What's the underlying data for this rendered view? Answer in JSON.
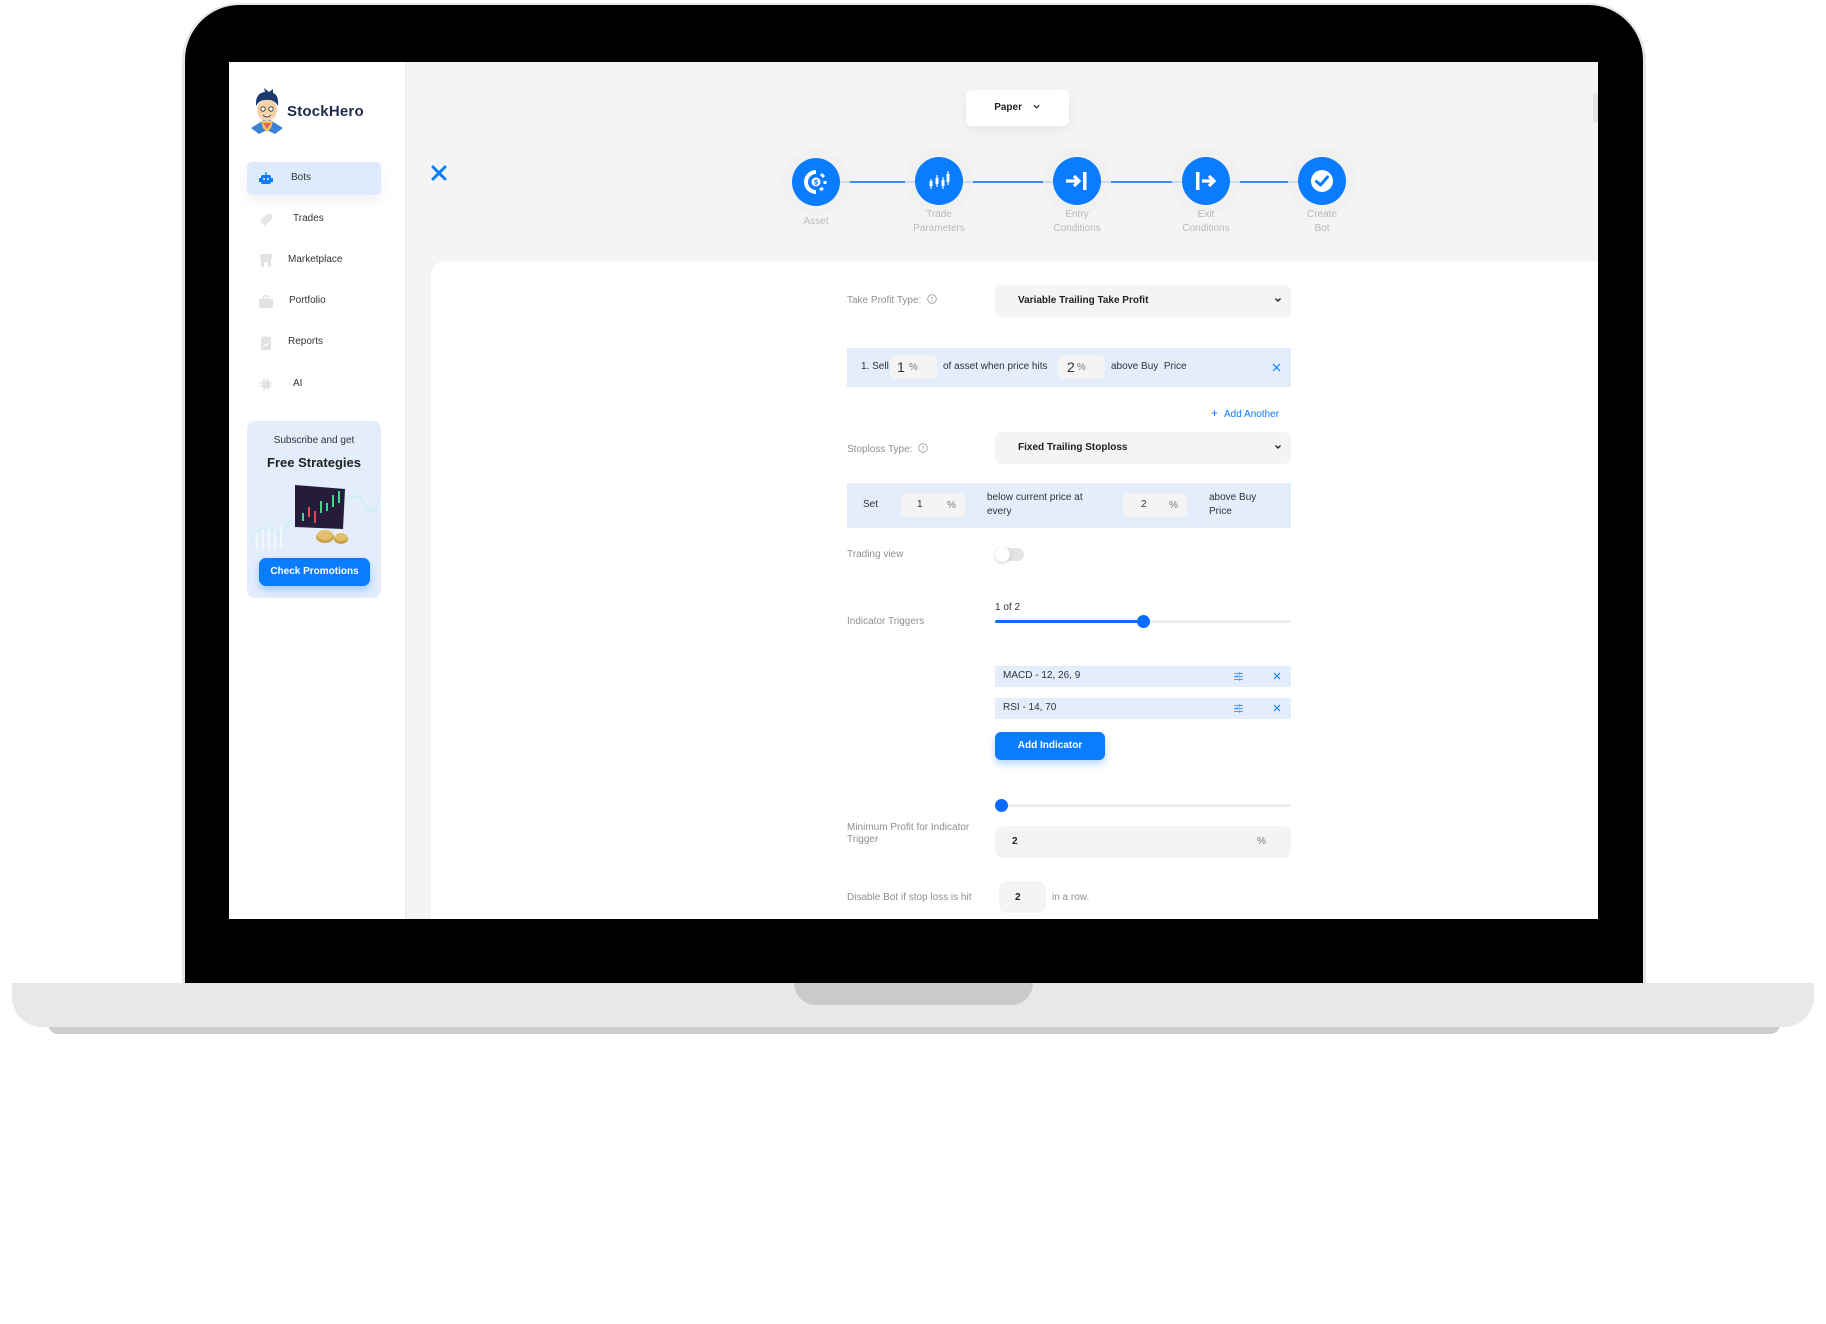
{
  "app": {
    "brand": "StockHero",
    "mode_selector": {
      "value": "Paper"
    }
  },
  "sidebar": {
    "items": [
      {
        "label": "Bots",
        "icon": "robot-icon",
        "active": true
      },
      {
        "label": "Trades",
        "icon": "tag-icon",
        "active": false
      },
      {
        "label": "Marketplace",
        "icon": "store-icon",
        "active": false
      },
      {
        "label": "Portfolio",
        "icon": "briefcase-icon",
        "active": false
      },
      {
        "label": "Reports",
        "icon": "report-icon",
        "active": false
      },
      {
        "label": "AI",
        "icon": "chip-icon",
        "active": false
      }
    ],
    "promo": {
      "subtitle": "Subscribe and get",
      "title": "Free Strategies",
      "button": "Check Promotions"
    }
  },
  "wizard": {
    "close_icon": "close-icon",
    "steps": [
      {
        "label": "Asset",
        "icon": "asset-coin-icon"
      },
      {
        "label": "Trade Parameters",
        "line1": "Trade",
        "line2": "Parameters",
        "icon": "candlestick-icon"
      },
      {
        "label": "Entry Conditions",
        "line1": "Entry",
        "line2": "Conditions",
        "icon": "entry-arrow-icon"
      },
      {
        "label": "Exit Conditions",
        "line1": "Exit",
        "line2": "Conditions",
        "icon": "exit-arrow-icon"
      },
      {
        "label": "Create Bot",
        "line1": "Create",
        "line2": "Bot",
        "icon": "check-circle-icon"
      }
    ]
  },
  "form": {
    "take_profit": {
      "label": "Take Profit Type:",
      "value": "Variable Trailing Take Profit",
      "rows": [
        {
          "prefix": "1. Sell",
          "sell_pct": "1",
          "unit1": "%",
          "mid": "of asset when price hits",
          "hit_pct": "2",
          "unit2": "%",
          "suffix": "above Buy  Price"
        }
      ],
      "add_another": "Add Another"
    },
    "stoploss": {
      "label": "Stoploss Type:",
      "value": "Fixed Trailing Stoploss",
      "row": {
        "prefix": "Set",
        "below_pct": "1",
        "unit1": "%",
        "mid": "below current price at every",
        "above_pct": "2",
        "unit2": "%",
        "suffix": "above Buy Price"
      }
    },
    "trading_view": {
      "label": "Trading view",
      "enabled": false
    },
    "indicator_triggers": {
      "label": "Indicator Triggers",
      "count_text": "1 of 2",
      "value": 1,
      "max": 2,
      "indicators": [
        {
          "text": "MACD - 12, 26, 9"
        },
        {
          "text": "RSI - 14, 70"
        }
      ],
      "add_button": "Add Indicator"
    },
    "min_profit": {
      "label": "Minimum Profit for Indicator Trigger",
      "slider_fraction": 0,
      "value": "2",
      "unit": "%"
    },
    "disable_bot": {
      "label": "Disable Bot if stop loss is hit",
      "value": "2",
      "suffix": "in a row."
    }
  },
  "colors": {
    "accent": "#0a7cff",
    "row_bg": "#e3edfc",
    "label_gray": "#8f8f8f",
    "brand_navy": "#1e2a4a"
  }
}
